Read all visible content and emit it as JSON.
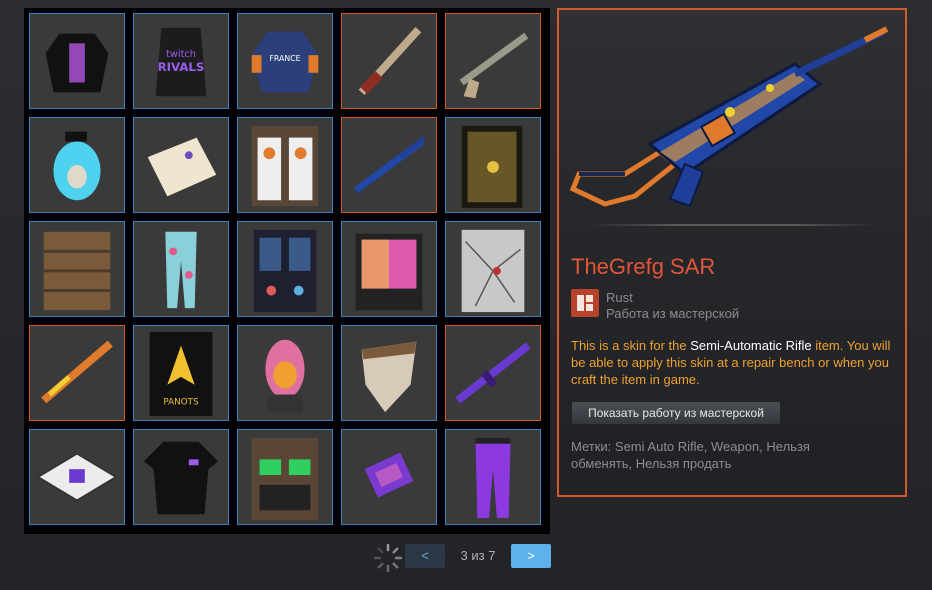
{
  "grid": {
    "items": [
      {
        "name": "purple skeleton hoodie",
        "border": "blue"
      },
      {
        "name": "twitch rivals sleeping bag",
        "border": "blue"
      },
      {
        "name": "france hockey hoodie",
        "border": "blue"
      },
      {
        "name": "bone rifle",
        "border": "orange"
      },
      {
        "name": "camo ak rifle",
        "border": "orange"
      },
      {
        "name": "blue penguin furnace",
        "border": "blue"
      },
      {
        "name": "map rug",
        "border": "blue"
      },
      {
        "name": "penguin vending machine",
        "border": "blue"
      },
      {
        "name": "blue semi auto rifle",
        "border": "orange"
      },
      {
        "name": "honeycomb locker door",
        "border": "blue"
      },
      {
        "name": "wooden garage door",
        "border": "blue"
      },
      {
        "name": "floral pants",
        "border": "blue"
      },
      {
        "name": "drink vending machine",
        "border": "blue"
      },
      {
        "name": "rainbow sheet door",
        "border": "blue"
      },
      {
        "name": "cracked glass door",
        "border": "blue"
      },
      {
        "name": "flame ak rifle",
        "border": "orange"
      },
      {
        "name": "paanots banner",
        "border": "blue"
      },
      {
        "name": "rainbow furnace",
        "border": "blue"
      },
      {
        "name": "fur bandana",
        "border": "blue"
      },
      {
        "name": "purple m4 rifle",
        "border": "orange"
      },
      {
        "name": "purple storage box",
        "border": "blue"
      },
      {
        "name": "twitch rivals t-shirt",
        "border": "blue"
      },
      {
        "name": "neon locker door",
        "border": "blue"
      },
      {
        "name": "purple card",
        "border": "blue"
      },
      {
        "name": "purple track pants",
        "border": "blue"
      }
    ]
  },
  "pager": {
    "prev_label": "<",
    "next_label": ">",
    "indicator": "3 из 7"
  },
  "detail": {
    "title": "TheGrefg SAR",
    "game": "Rust",
    "game_sub": "Работа из мастерской",
    "desc_pre": "This is a skin for the ",
    "desc_item": "Semi-Automatic Rifle",
    "desc_post": " item. You will be able to apply this skin at a repair bench or when you craft the item in game.",
    "workshop_button": "Показать работу из мастерской",
    "tags": "Метки: Semi Auto Rifle, Weapon, Нельзя обменять, Нельзя продать"
  },
  "colors": {
    "accent_orange": "#d4592b",
    "accent_blue": "#3b7fc4",
    "title_red": "#e4553a",
    "desc_orange": "#f0a030"
  }
}
